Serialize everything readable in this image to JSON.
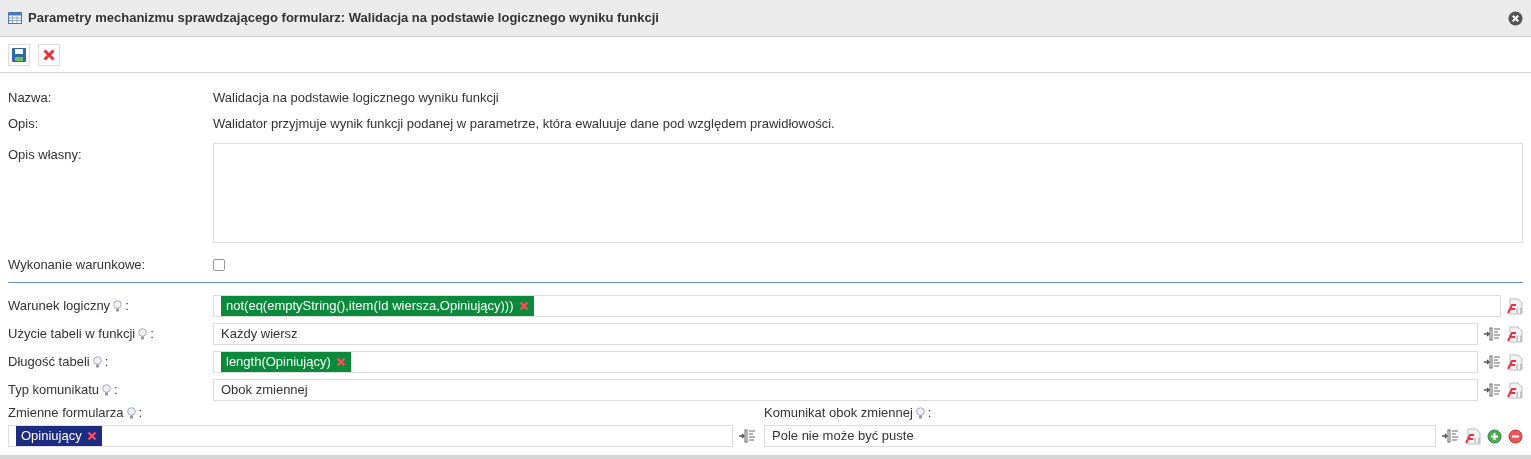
{
  "window": {
    "title": "Parametry mechanizmu sprawdzającego formularz: Walidacja na podstawie logicznego wyniku funkcji"
  },
  "toolbar": [
    {
      "kind": "save"
    },
    {
      "kind": "cancel"
    }
  ],
  "info": [
    {
      "label": "Nazwa:",
      "value": "Walidacja na podstawie logicznego wyniku funkcji"
    },
    {
      "label": "Opis:",
      "value": "Walidator przyjmuje wynik funkcji podanej w parametrze, która ewaluuje dane pod względem prawidłowości."
    }
  ],
  "custom_description": {
    "label": "Opis własny:"
  },
  "conditional": {
    "label": "Wykonanie warunkowe:",
    "checked": false
  },
  "params": [
    {
      "label": "Warunek logiczny",
      "suffix": ":",
      "kind": "tags",
      "tags": [
        {
          "text": "not(eq(emptyString(),item(Id wiersza,Opiniujący)))",
          "color": "#0b8a3b"
        }
      ],
      "actions": [
        {
          "kind": "function"
        }
      ]
    },
    {
      "label": "Użycie tabeli w funkcji",
      "suffix": ":",
      "kind": "text",
      "value": "Każdy wiersz",
      "actions": [
        {
          "kind": "insert"
        },
        {
          "kind": "function"
        }
      ]
    },
    {
      "label": "Długość tabeli",
      "suffix": ":",
      "kind": "tags",
      "tags": [
        {
          "text": "length(Opiniujący)",
          "color": "#0b8a3b"
        }
      ],
      "actions": [
        {
          "kind": "insert"
        },
        {
          "kind": "function"
        }
      ]
    },
    {
      "label": "Typ komunikatu",
      "suffix": ":",
      "kind": "text",
      "value": "Obok zmiennej",
      "actions": [
        {
          "kind": "insert"
        },
        {
          "kind": "function"
        }
      ]
    }
  ],
  "pairs": [
    {
      "label": "Zmienne formularza",
      "suffix": ":",
      "kind": "tags",
      "tags": [
        {
          "text": "Opiniujący",
          "color": "#1d2b80"
        }
      ],
      "actions": [
        {
          "kind": "insert"
        }
      ]
    },
    {
      "label": "Komunikat obok zmiennej",
      "suffix": ":",
      "kind": "text",
      "value": "Pole nie może być puste",
      "actions": [
        {
          "kind": "insert"
        },
        {
          "kind": "function"
        },
        {
          "kind": "add"
        },
        {
          "kind": "remove"
        }
      ]
    }
  ]
}
